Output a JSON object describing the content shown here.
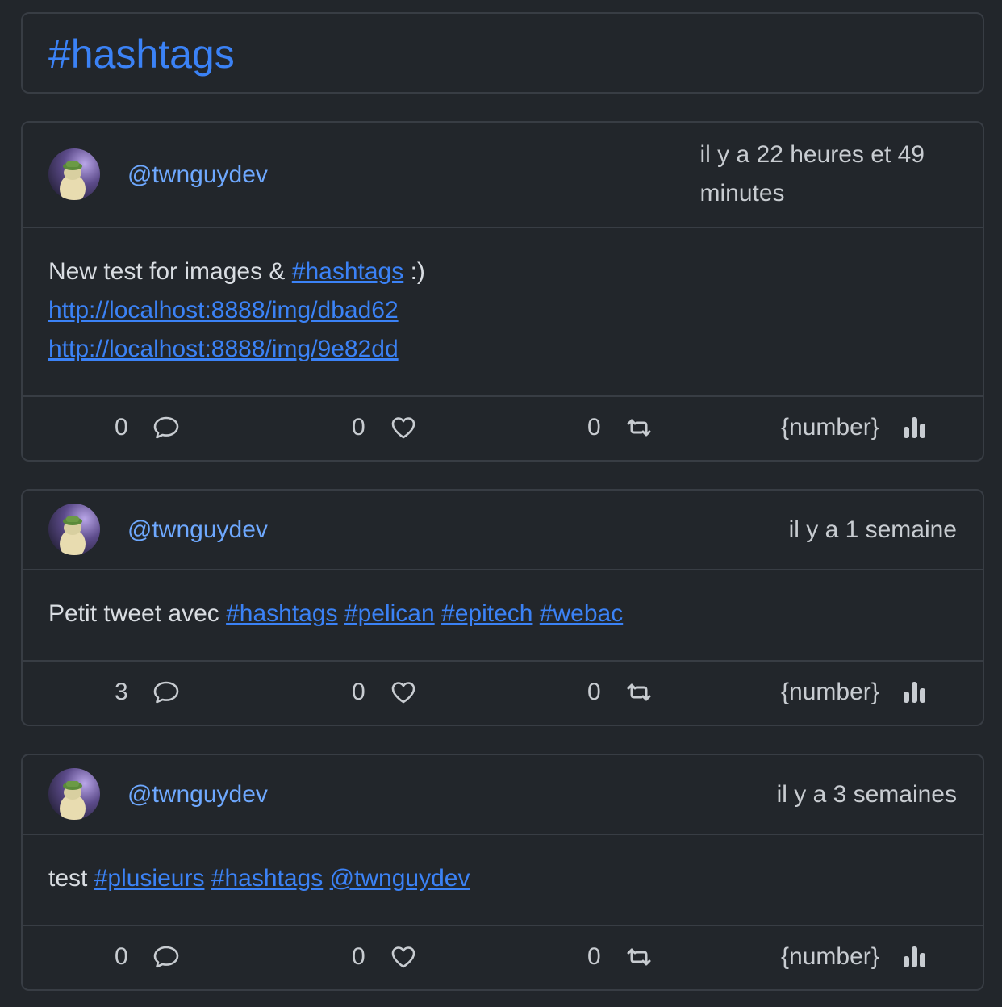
{
  "page": {
    "title": "#hashtags"
  },
  "colors": {
    "background": "#22262b",
    "border": "#383d44",
    "link": "#3b82f6",
    "handle": "#6ea8fe",
    "text": "#d9dde2",
    "muted": "#c8ccd1"
  },
  "posts": [
    {
      "author": "@twnguydev",
      "time_line1": "il y a 22 heures et 49",
      "time_line2": "minutes",
      "text_prefix": "New test for images & ",
      "hashtag": "#hashtags",
      "text_suffix": " :)",
      "link1": "http://localhost:8888/img/dbad62",
      "link2": "http://localhost:8888/img/9e82dd",
      "replies": "0",
      "likes": "0",
      "retweets": "0",
      "views": "{number}"
    },
    {
      "author": "@twnguydev",
      "time": "il y a 1 semaine",
      "text_prefix": "Petit tweet avec ",
      "tags": [
        "#hashtags",
        "#pelican",
        "#epitech",
        "#webac"
      ],
      "replies": "3",
      "likes": "0",
      "retweets": "0",
      "views": "{number}"
    },
    {
      "author": "@twnguydev",
      "time": "il y a 3 semaines",
      "text_prefix": "test ",
      "tags": [
        "#plusieurs",
        "#hashtags",
        "@twnguydev"
      ],
      "replies": "0",
      "likes": "0",
      "retweets": "0",
      "views": "{number}"
    }
  ],
  "icons": {
    "reply": "comment-bubble-icon",
    "like": "heart-icon",
    "retweet": "retweet-icon",
    "views": "bar-chart-icon"
  }
}
